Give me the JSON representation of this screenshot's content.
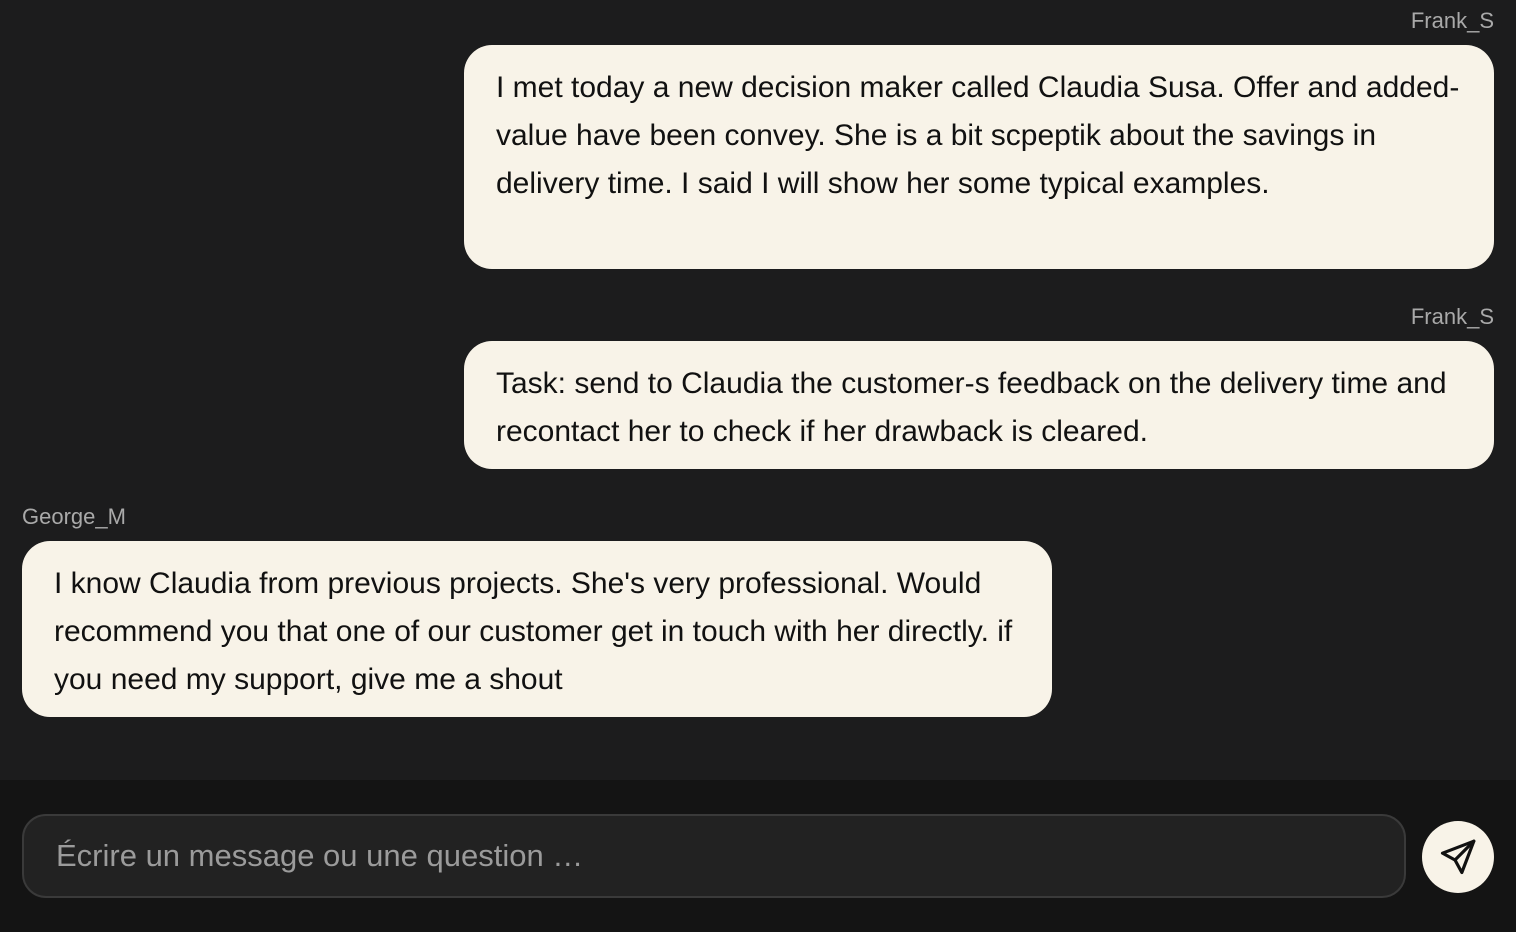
{
  "messages": [
    {
      "sender": "Frank_S",
      "text": "I met today a new decision maker called Claudia Susa. Offer and added-value have been convey. She is a bit scpeptik about the savings in delivery time. I said I will show her some typical examples."
    },
    {
      "sender": "Frank_S",
      "text": "Task: send to Claudia the customer-s feedback on the delivery time and recontact her to check if her drawback is cleared."
    },
    {
      "sender": "George_M",
      "text": "I know Claudia from previous projects. She's very professional. Would recommend you that one of our customer get in touch with her directly. if you need my support, give me a shout"
    }
  ],
  "composer": {
    "value": "",
    "placeholder": "Écrire un message ou une question …"
  },
  "icons": {
    "send": "paper-plane-icon"
  }
}
